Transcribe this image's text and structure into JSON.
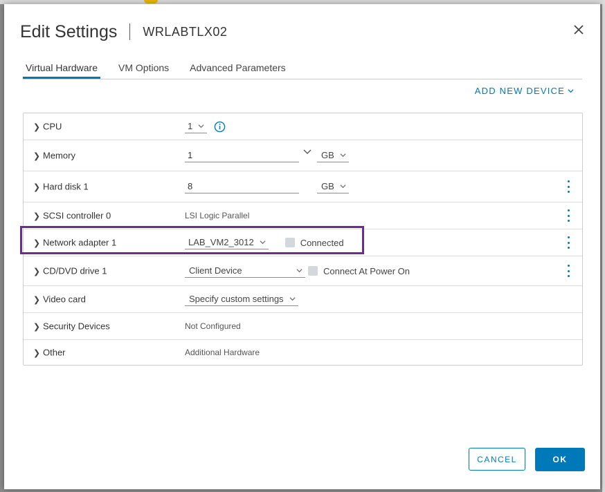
{
  "dialog": {
    "title": "Edit Settings",
    "vm_name": "WRLABTLX02"
  },
  "tabs": [
    {
      "label": "Virtual Hardware",
      "active": true
    },
    {
      "label": "VM Options",
      "active": false
    },
    {
      "label": "Advanced Parameters",
      "active": false
    }
  ],
  "add_device": {
    "label": "ADD NEW DEVICE",
    "icon": "chevron-down-icon"
  },
  "hardware": {
    "cpu": {
      "label": "CPU",
      "value": "1"
    },
    "memory": {
      "label": "Memory",
      "value": "1",
      "unit": "GB"
    },
    "hard_disk": {
      "label": "Hard disk 1",
      "value": "8",
      "unit": "GB"
    },
    "scsi": {
      "label": "SCSI controller 0",
      "value": "LSI Logic Parallel"
    },
    "network": {
      "label": "Network adapter 1",
      "value": "LAB_VM2_3012",
      "connected_label": "Connected",
      "connected": false
    },
    "cddvd": {
      "label": "CD/DVD drive 1",
      "value": "Client Device",
      "power_on_label": "Connect At Power On",
      "power_on": false
    },
    "video": {
      "label": "Video card",
      "value": "Specify custom settings"
    },
    "security": {
      "label": "Security Devices",
      "value": "Not Configured"
    },
    "other": {
      "label": "Other",
      "value": "Additional Hardware"
    }
  },
  "footer": {
    "cancel_label": "CANCEL",
    "ok_label": "OK"
  },
  "colors": {
    "accent": "#0079b8",
    "highlight": "#6b2c91"
  }
}
